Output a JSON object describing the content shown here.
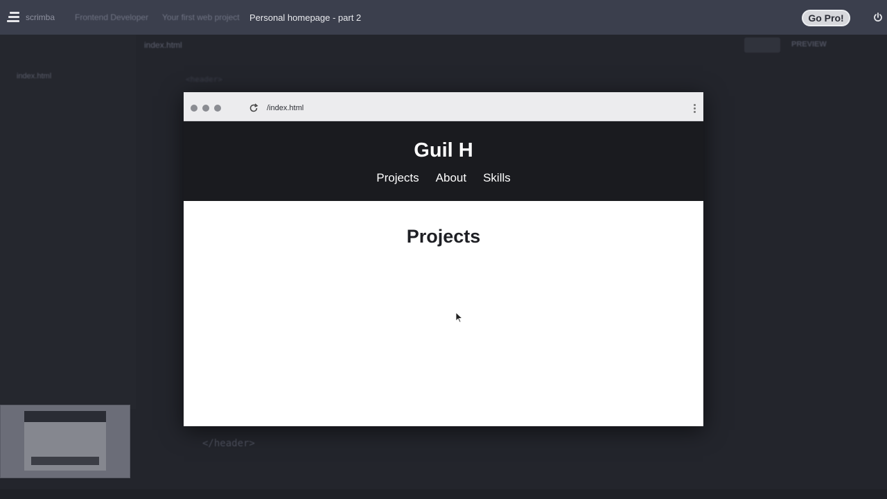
{
  "topbar": {
    "brand": "scrimba",
    "crumbs": [
      "Frontend Developer",
      "Your first web project"
    ],
    "active_crumb": "Personal homepage - part 2",
    "go_pro_label": "Go Pro!"
  },
  "editor": {
    "file_tab": "index.html",
    "file_item": "index.html",
    "preview_label": "PREVIEW",
    "code_line": "</header>"
  },
  "browser": {
    "url": "/index.html"
  },
  "site": {
    "title": "Guil H",
    "nav": [
      "Projects",
      "About",
      "Skills"
    ],
    "section_heading": "Projects"
  },
  "icons": {
    "logo": "scrimba-logo-icon",
    "power": "power-icon",
    "reload": "reload-icon",
    "menu": "kebab-menu-icon",
    "cursor": "mouse-cursor-icon"
  }
}
